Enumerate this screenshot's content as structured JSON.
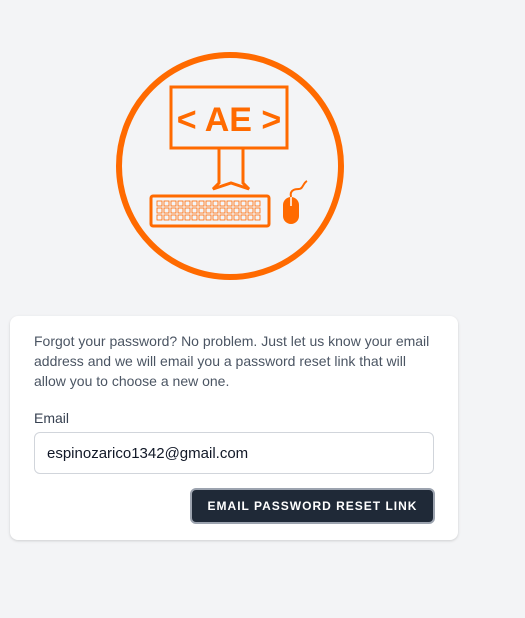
{
  "logo": {
    "text": "< AE >",
    "accent_color": "#ff6a00"
  },
  "form": {
    "intro_text": "Forgot your password? No problem. Just let us know your email address and we will email you a password reset link that will allow you to choose a new one.",
    "email_label": "Email",
    "email_value": "espinozarico1342@gmail.com",
    "submit_label": "Email Password Reset Link"
  }
}
